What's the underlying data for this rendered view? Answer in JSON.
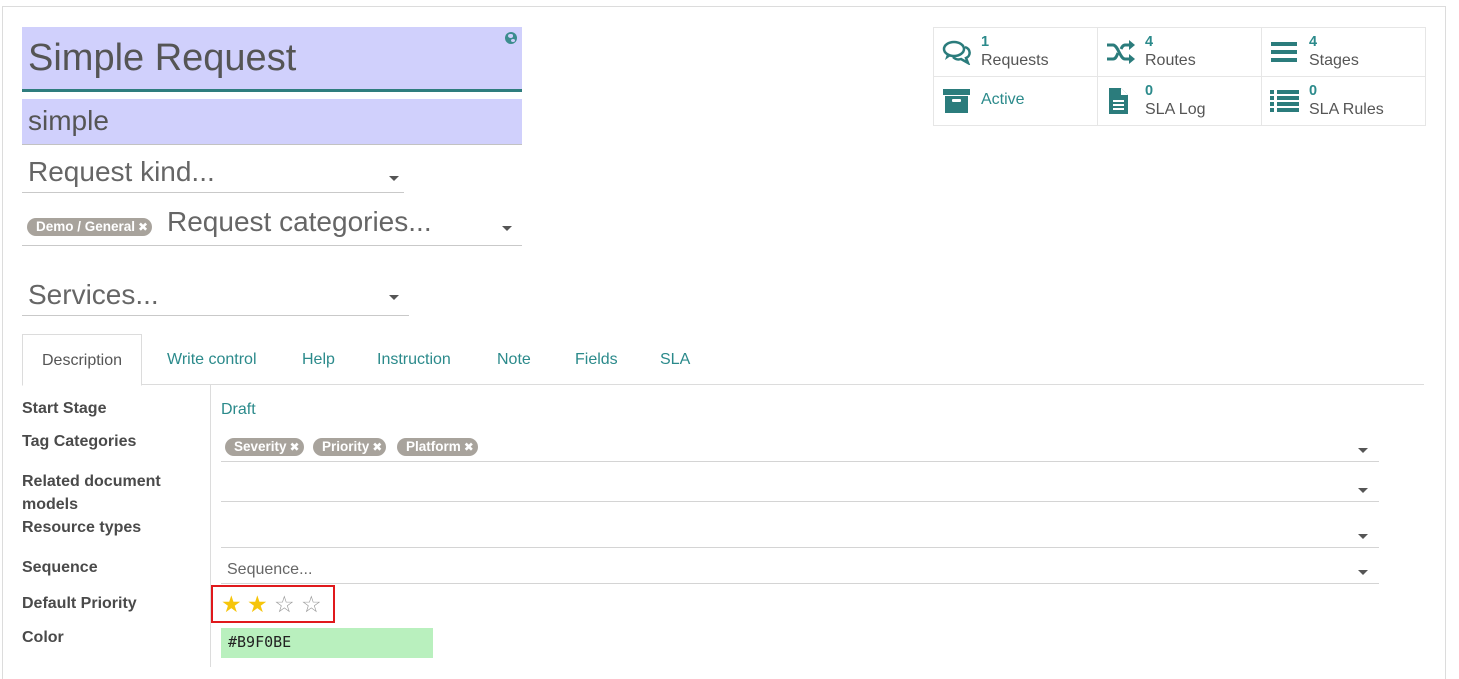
{
  "header": {
    "name": "Simple Request",
    "code": "simple",
    "request_kind_placeholder": "Request kind...",
    "request_categories_placeholder": "Request categories...",
    "category_tags": [
      "Demo / General"
    ],
    "services_placeholder": "Services..."
  },
  "stat_buttons": [
    {
      "count": "1",
      "label": "Requests",
      "icon": "comments-icon"
    },
    {
      "count": "4",
      "label": "Routes",
      "icon": "random-icon"
    },
    {
      "count": "4",
      "label": "Stages",
      "icon": "bars-icon"
    },
    {
      "count": "",
      "label": "Active",
      "icon": "archive-icon"
    },
    {
      "count": "0",
      "label": "SLA Log",
      "icon": "file-icon"
    },
    {
      "count": "0",
      "label": "SLA Rules",
      "icon": "list-icon"
    }
  ],
  "tabs": [
    "Description",
    "Write control",
    "Help",
    "Instruction",
    "Note",
    "Fields",
    "SLA"
  ],
  "form": {
    "start_stage": {
      "label": "Start Stage",
      "value": "Draft"
    },
    "tag_categories": {
      "label": "Tag Categories",
      "tags": [
        "Severity",
        "Priority",
        "Platform"
      ]
    },
    "related_document_models": {
      "label": "Related document models"
    },
    "resource_types": {
      "label": "Resource types"
    },
    "sequence": {
      "label": "Sequence",
      "placeholder": "Sequence..."
    },
    "default_priority": {
      "label": "Default Priority",
      "value": 2,
      "max": 4
    },
    "color": {
      "label": "Color",
      "value": "#B9F0BE"
    }
  },
  "colors": {
    "accent": "#2b8a8b",
    "title_background": "#d0d0fc",
    "tag": "#a8a39c",
    "star_on": "#f6c50b",
    "highlight_box": "#e0191c",
    "color_swatch": "#b9f0be"
  }
}
